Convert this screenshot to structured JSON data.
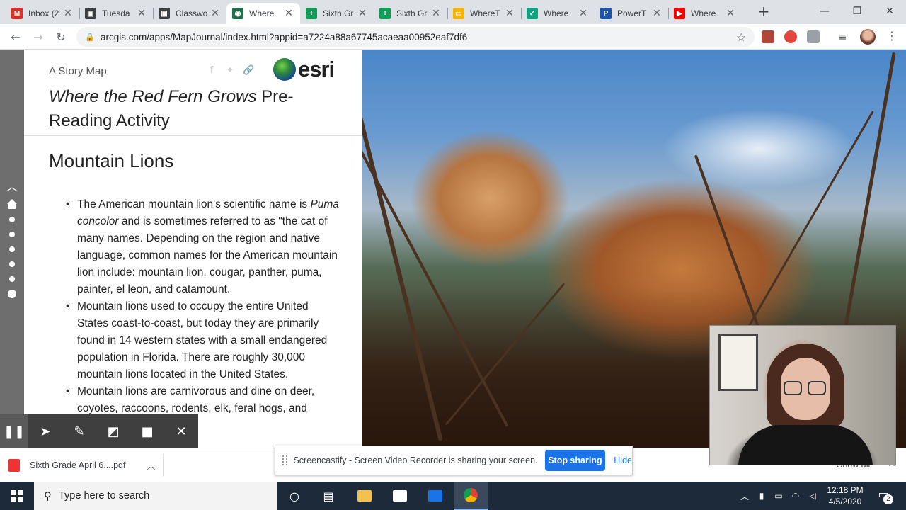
{
  "browser": {
    "tabs": [
      {
        "title": "Inbox (2",
        "favicon": "gmail-icon",
        "color": "#d93025",
        "glyph": "M"
      },
      {
        "title": "Tuesda",
        "favicon": "classroom-icon",
        "color": "#3c4043",
        "glyph": "▣"
      },
      {
        "title": "Classwo",
        "favicon": "classroom-icon",
        "color": "#3c4043",
        "glyph": "▣"
      },
      {
        "title": "Where",
        "favicon": "globe-icon",
        "color": "#1e6f4a",
        "glyph": "◉",
        "active": true
      },
      {
        "title": "Sixth Gr",
        "favicon": "sheets-icon",
        "color": "#0f9d58",
        "glyph": "+"
      },
      {
        "title": "Sixth Gr",
        "favicon": "sheets-icon",
        "color": "#0f9d58",
        "glyph": "+"
      },
      {
        "title": "WhereT",
        "favicon": "slides-icon",
        "color": "#f4b400",
        "glyph": "▭"
      },
      {
        "title": "Where",
        "favicon": "edpuzzle-icon",
        "color": "#10a37f",
        "glyph": "✓"
      },
      {
        "title": "PowerT",
        "favicon": "powerpoint-icon",
        "color": "#1a56b0",
        "glyph": "P"
      },
      {
        "title": "Where",
        "favicon": "youtube-icon",
        "color": "#ff0000",
        "glyph": "▶"
      }
    ],
    "new_tab": "+",
    "url": "arcgis.com/apps/MapJournal/index.html?appid=a7224a88a67745acaeaa00952eaf7df6"
  },
  "story": {
    "subtitle": "A Story Map",
    "title_italic": "Where the Red Fern Grows",
    "title_rest": " Pre-Reading Activity",
    "logo_text": "esri",
    "section_title": "Mountain Lions",
    "bullets": [
      {
        "parts": [
          {
            "t": "The American mountain lion's scientific name is "
          },
          {
            "t": "Puma concolor",
            "i": true
          },
          {
            "t": " and is sometimes referred to as \"the cat of many names. Depending on the region and native language, common names for the American mountain lion include: mountain lion, cougar, panther, puma, painter, el leon, and catamount."
          }
        ]
      },
      {
        "parts": [
          {
            "t": "Mountain lions used to occupy the entire United States coast-to-coast, but today they are primarily found in 14 western states with a small endangered population in Florida. There are roughly 30,000 mountain lions located in the United States."
          }
        ]
      },
      {
        "parts": [
          {
            "t": "Mountain lions are carnivorous and dine on deer, coyotes, raccoons, rodents, elk, feral hogs, and"
          }
        ]
      }
    ]
  },
  "screencastify": {
    "message": "Screencastify - Screen Video Recorder is sharing your screen.",
    "stop_label": "Stop sharing",
    "hide_label": "Hide"
  },
  "downloads": {
    "file_name": "Sixth Grade April 6....pdf",
    "show_all": "Show all"
  },
  "taskbar": {
    "search_placeholder": "Type here to search",
    "time": "12:18 PM",
    "date": "4/5/2020",
    "notification_count": "2"
  }
}
